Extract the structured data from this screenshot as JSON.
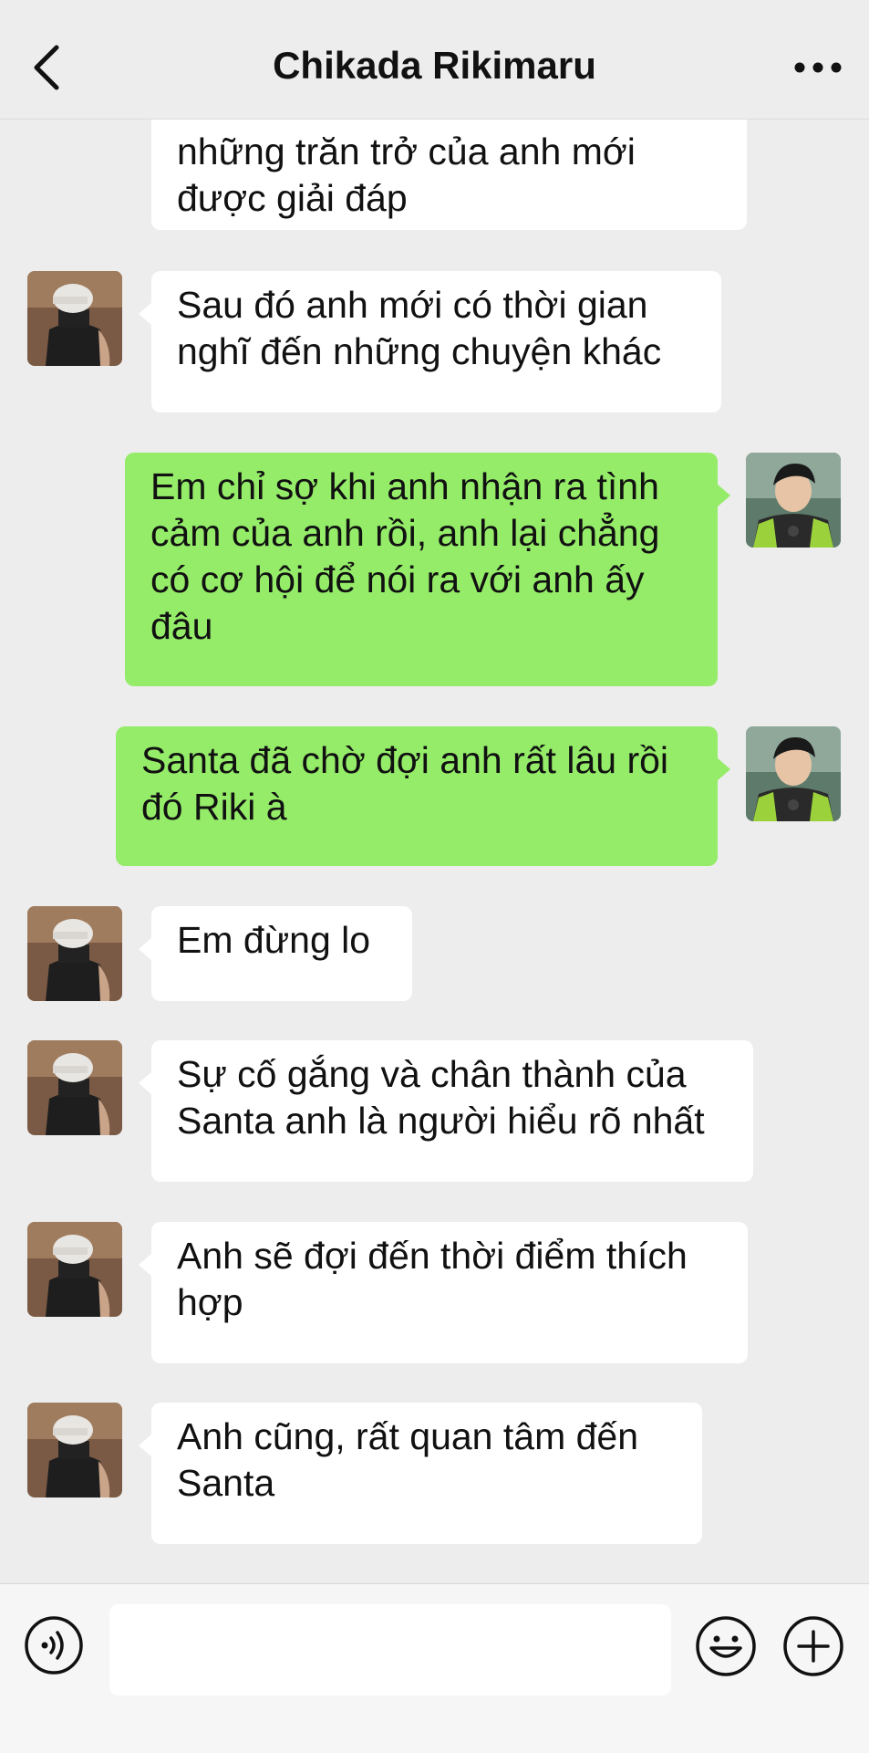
{
  "header": {
    "title": "Chikada Rikimaru",
    "back_icon": "chevron-left-icon",
    "more_icon": "more-dots-icon"
  },
  "messages": [
    {
      "sender": "contact",
      "text": "những trăn trở của anh mới được giải đáp"
    },
    {
      "sender": "contact",
      "text": "Sau đó anh mới có thời gian nghĩ đến những chuyện khác"
    },
    {
      "sender": "me",
      "text": "Em chỉ sợ khi anh nhận ra tình cảm của anh rồi, anh lại chẳng có cơ hội để nói ra với anh ấy đâu"
    },
    {
      "sender": "me",
      "text": "Santa đã chờ đợi anh rất lâu rồi đó Riki à"
    },
    {
      "sender": "contact",
      "text": "Em đừng lo"
    },
    {
      "sender": "contact",
      "text": "Sự cố gắng và chân thành của Santa anh là người hiểu rõ nhất"
    },
    {
      "sender": "contact",
      "text": "Anh sẽ đợi đến thời điểm thích hợp"
    },
    {
      "sender": "contact",
      "text": "Anh cũng, rất quan tâm đến Santa"
    }
  ],
  "input_bar": {
    "voice_icon": "voice-icon",
    "input_value": "",
    "emoji_icon": "emoji-icon",
    "plus_icon": "plus-icon"
  },
  "colors": {
    "background": "#ededed",
    "incoming_bubble": "#ffffff",
    "outgoing_bubble": "#95ec69",
    "text": "#111111"
  }
}
